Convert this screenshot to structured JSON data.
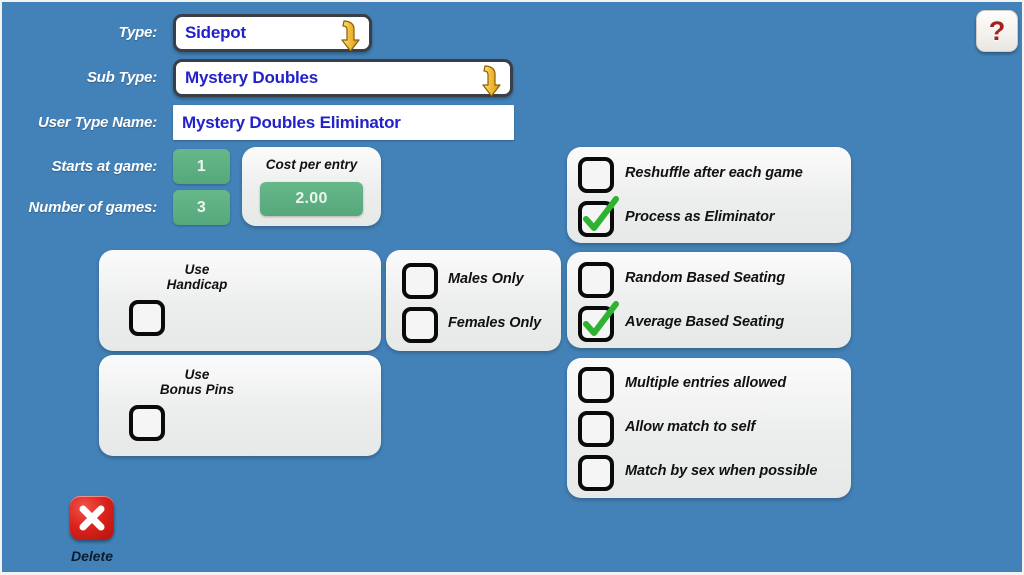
{
  "theme": {
    "background": "#4382b8",
    "panel_background": "#eceeed",
    "field_value_color": "#2222c8",
    "green_value_color": "#55a87b",
    "delete_color": "#da221c",
    "help_color": "#a51f1f",
    "check_color": "#2fb22f"
  },
  "form": {
    "type": {
      "label": "Type:",
      "value": "Sidepot",
      "dropdown_icon": "down-arrow-icon"
    },
    "sub_type": {
      "label": "Sub Type:",
      "value": "Mystery Doubles",
      "dropdown_icon": "down-arrow-icon"
    },
    "user_type_name": {
      "label": "User Type Name:",
      "value": "Mystery Doubles Eliminator"
    },
    "starts_at_game": {
      "label": "Starts at game:",
      "value": "1"
    },
    "number_of_games": {
      "label": "Number of games:",
      "value": "3"
    },
    "cost_per_entry": {
      "title": "Cost per entry",
      "value": "2.00"
    }
  },
  "panels": {
    "use_handicap": {
      "title": "Use\nHandicap",
      "checked": false
    },
    "use_bonus_pins": {
      "title": "Use\nBonus Pins",
      "checked": false
    },
    "gender": {
      "options": [
        {
          "label": "Males Only",
          "checked": false
        },
        {
          "label": "Females Only",
          "checked": false
        }
      ]
    },
    "processing": {
      "options": [
        {
          "label": "Reshuffle after each game",
          "checked": false
        },
        {
          "label": "Process as Eliminator",
          "checked": true
        }
      ]
    },
    "seating": {
      "options": [
        {
          "label": "Random Based Seating",
          "checked": false
        },
        {
          "label": "Average Based Seating",
          "checked": true
        }
      ]
    },
    "matching": {
      "options": [
        {
          "label": "Multiple entries allowed",
          "checked": false
        },
        {
          "label": "Allow match to self",
          "checked": false
        },
        {
          "label": "Match by sex when possible",
          "checked": false
        }
      ]
    }
  },
  "actions": {
    "delete": {
      "label": "Delete",
      "icon": "close-x-icon"
    },
    "help": {
      "glyph": "?",
      "icon": "question-mark-icon"
    }
  }
}
